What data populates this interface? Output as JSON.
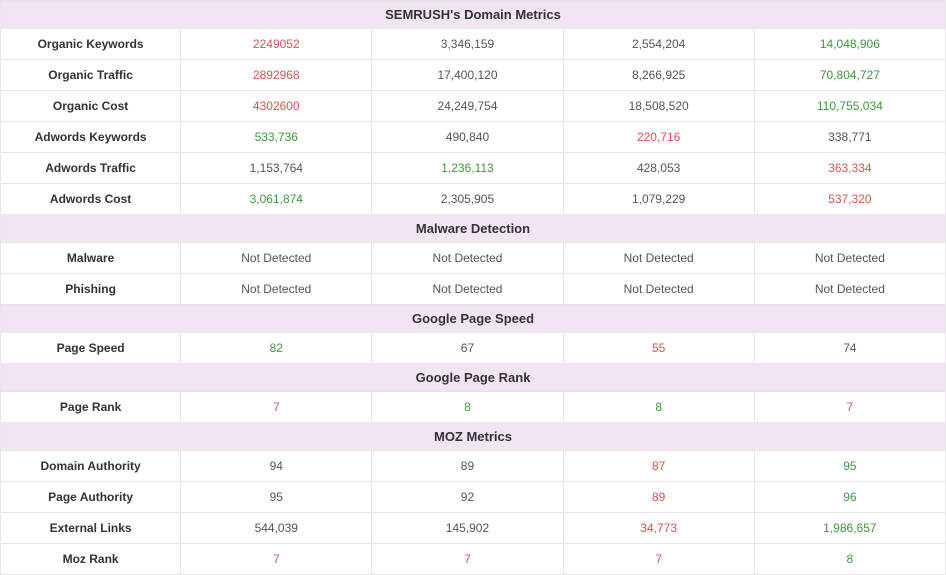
{
  "sections": [
    {
      "title": "SEMRUSH's Domain Metrics",
      "rows": [
        {
          "label": "Organic Keywords",
          "cells": [
            {
              "v": "2249052",
              "c": "red"
            },
            {
              "v": "3,346,159",
              "c": ""
            },
            {
              "v": "2,554,204",
              "c": ""
            },
            {
              "v": "14,048,906",
              "c": "green"
            }
          ]
        },
        {
          "label": "Organic Traffic",
          "cells": [
            {
              "v": "2892968",
              "c": "red"
            },
            {
              "v": "17,400,120",
              "c": ""
            },
            {
              "v": "8,266,925",
              "c": ""
            },
            {
              "v": "70,804,727",
              "c": "green"
            }
          ]
        },
        {
          "label": "Organic Cost",
          "cells": [
            {
              "v": "4302600",
              "c": "red"
            },
            {
              "v": "24,249,754",
              "c": ""
            },
            {
              "v": "18,508,520",
              "c": ""
            },
            {
              "v": "110,755,034",
              "c": "green"
            }
          ]
        },
        {
          "label": "Adwords Keywords",
          "cells": [
            {
              "v": "533,736",
              "c": "green"
            },
            {
              "v": "490,840",
              "c": ""
            },
            {
              "v": "220,716",
              "c": "red"
            },
            {
              "v": "338,771",
              "c": ""
            }
          ]
        },
        {
          "label": "Adwords Traffic",
          "cells": [
            {
              "v": "1,153,764",
              "c": ""
            },
            {
              "v": "1,236,113",
              "c": "green"
            },
            {
              "v": "428,053",
              "c": ""
            },
            {
              "v": "363,334",
              "c": "red"
            }
          ]
        },
        {
          "label": "Adwords Cost",
          "cells": [
            {
              "v": "3,061,874",
              "c": "green"
            },
            {
              "v": "2,305,905",
              "c": ""
            },
            {
              "v": "1,079,229",
              "c": ""
            },
            {
              "v": "537,320",
              "c": "red"
            }
          ]
        }
      ]
    },
    {
      "title": "Malware Detection",
      "rows": [
        {
          "label": "Malware",
          "cells": [
            {
              "v": "Not Detected",
              "c": ""
            },
            {
              "v": "Not Detected",
              "c": ""
            },
            {
              "v": "Not Detected",
              "c": ""
            },
            {
              "v": "Not Detected",
              "c": ""
            }
          ]
        },
        {
          "label": "Phishing",
          "cells": [
            {
              "v": "Not Detected",
              "c": ""
            },
            {
              "v": "Not Detected",
              "c": ""
            },
            {
              "v": "Not Detected",
              "c": ""
            },
            {
              "v": "Not Detected",
              "c": ""
            }
          ]
        }
      ]
    },
    {
      "title": "Google Page Speed",
      "rows": [
        {
          "label": "Page Speed",
          "cells": [
            {
              "v": "82",
              "c": "green"
            },
            {
              "v": "67",
              "c": ""
            },
            {
              "v": "55",
              "c": "red"
            },
            {
              "v": "74",
              "c": ""
            }
          ]
        }
      ]
    },
    {
      "title": "Google Page Rank",
      "rows": [
        {
          "label": "Page Rank",
          "cells": [
            {
              "v": "7",
              "c": "red"
            },
            {
              "v": "8",
              "c": "green"
            },
            {
              "v": "8",
              "c": "green"
            },
            {
              "v": "7",
              "c": "red"
            }
          ]
        }
      ]
    },
    {
      "title": "MOZ Metrics",
      "rows": [
        {
          "label": "Domain Authority",
          "cells": [
            {
              "v": "94",
              "c": ""
            },
            {
              "v": "89",
              "c": ""
            },
            {
              "v": "87",
              "c": "red"
            },
            {
              "v": "95",
              "c": "green"
            }
          ]
        },
        {
          "label": "Page Authority",
          "cells": [
            {
              "v": "95",
              "c": ""
            },
            {
              "v": "92",
              "c": ""
            },
            {
              "v": "89",
              "c": "red"
            },
            {
              "v": "96",
              "c": "green"
            }
          ]
        },
        {
          "label": "External Links",
          "cells": [
            {
              "v": "544,039",
              "c": ""
            },
            {
              "v": "145,902",
              "c": ""
            },
            {
              "v": "34,773",
              "c": "red"
            },
            {
              "v": "1,986,657",
              "c": "green"
            }
          ]
        },
        {
          "label": "Moz Rank",
          "cells": [
            {
              "v": "7",
              "c": "red"
            },
            {
              "v": "7",
              "c": "red"
            },
            {
              "v": "7",
              "c": "red"
            },
            {
              "v": "8",
              "c": "green"
            }
          ]
        }
      ]
    }
  ]
}
